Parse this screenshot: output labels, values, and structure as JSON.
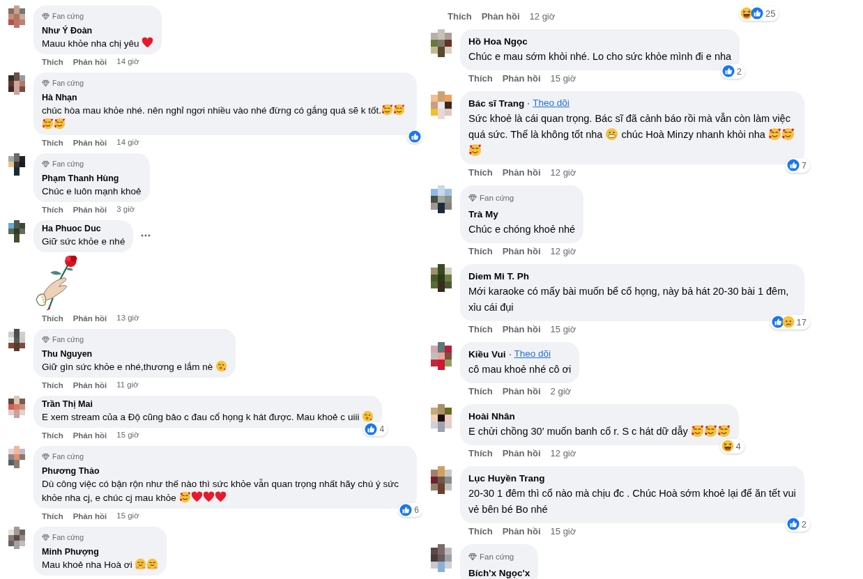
{
  "columns": [
    {
      "comments": [
        {
          "badge": "Fan cứng",
          "name": "Như Ý Đoàn",
          "segments": [
            {
              "kind": "text",
              "text": "Mauu khỏe nha chị yêu "
            },
            {
              "kind": "heart"
            }
          ],
          "actions": {
            "like": "Thích",
            "reply": "Phản hồi",
            "time": "14 giờ"
          }
        },
        {
          "badge": "Fan cứng",
          "name": "Hà Nhạn",
          "segments": [
            {
              "kind": "text",
              "text": "chúc hòa mau khỏe nhé. nên nghỉ ngơi nhiều vào nhé đừng có gắng quá sẽ k tốt."
            },
            {
              "kind": "hearts-face"
            },
            {
              "kind": "hearts-face"
            },
            {
              "kind": "hearts-face"
            },
            {
              "kind": "hearts-face"
            }
          ],
          "reactions": {
            "icons": [
              {
                "kind": "like"
              }
            ]
          },
          "actions": {
            "like": "Thích",
            "reply": "Phản hồi",
            "time": "14 giờ"
          }
        },
        {
          "badge": "Fan cứng",
          "name": "Phạm Thanh Hùng",
          "segments": [
            {
              "kind": "text",
              "text": "Chúc e luôn mạnh khoẻ"
            }
          ],
          "actions": {
            "like": "Thích",
            "reply": "Phản hồi",
            "time": "3 giờ"
          }
        },
        {
          "name": "Ha Phuoc Duc",
          "segments": [
            {
              "kind": "text",
              "text": "Giữ sức khỏe e nhé"
            }
          ],
          "more_menu": true,
          "sticker": true,
          "actions": {
            "like": "Thích",
            "reply": "Phản hồi",
            "time": "13 giờ"
          }
        },
        {
          "badge": "Fan cứng",
          "name": "Thu Nguyen",
          "segments": [
            {
              "kind": "text",
              "text": "Giữ gìn sức khỏe e nhé,thương e lắm nè "
            },
            {
              "kind": "kiss-face"
            }
          ],
          "actions": {
            "like": "Thích",
            "reply": "Phản hồi",
            "time": "11 giờ"
          }
        },
        {
          "name": "Trần Thị Mai",
          "segments": [
            {
              "kind": "text",
              "text": "E xem stream của a Độ cũng bảo c đau cổ họng k hát được. Mau khoẻ c uiii "
            },
            {
              "kind": "kiss-face"
            }
          ],
          "reactions": {
            "icons": [
              {
                "kind": "like"
              }
            ],
            "count": "4"
          },
          "actions": {
            "like": "Thích",
            "reply": "Phản hồi",
            "time": "15 giờ"
          }
        },
        {
          "badge": "Fan cứng",
          "name": "Phương Thảo",
          "segments": [
            {
              "kind": "text",
              "text": "Dù công việc có bận rộn như thế nào thì sức khỏe vẫn quan trọng nhất hãy chú ý sức khỏe nha cj, e chúc cj mau khỏe "
            },
            {
              "kind": "hearts-face"
            },
            {
              "kind": "heart"
            },
            {
              "kind": "heart"
            },
            {
              "kind": "heart"
            }
          ],
          "reactions": {
            "icons": [
              {
                "kind": "like"
              }
            ],
            "count": "6"
          },
          "actions": {
            "like": "Thích",
            "reply": "Phản hồi",
            "time": "15 giờ"
          }
        },
        {
          "badge": "Fan cứng",
          "name": "Minh Phượng",
          "segments": [
            {
              "kind": "text",
              "text": "Mau khoẻ nha Hoà ơi "
            },
            {
              "kind": "hug-face"
            },
            {
              "kind": "hug-face"
            }
          ]
        }
      ]
    },
    {
      "comments": [
        {
          "reactions": {
            "icons": [
              {
                "kind": "haha"
              },
              {
                "kind": "like"
              }
            ],
            "count": "25"
          },
          "actions": {
            "like": "Thích",
            "reply": "Phản hồi",
            "time": "12 giờ"
          }
        },
        {
          "name": "Hồ Hoa Ngọc",
          "segments": [
            {
              "kind": "text",
              "text": "Chúc e mau sớm khỏi nhé. Lo cho sức khỏe mình đi e nha"
            }
          ],
          "reactions": {
            "icons": [
              {
                "kind": "like"
              }
            ],
            "count": "2"
          },
          "actions": {
            "like": "Thích",
            "reply": "Phản hồi",
            "time": "15 giờ"
          }
        },
        {
          "name": "Bác sĩ Trang",
          "follow": "Theo dõi",
          "segments": [
            {
              "kind": "text",
              "text": "Sức khoẻ là cái quan trọng. Bác sĩ đã cảnh báo rồi mà vẫn còn làm việc quá sức. Thế là không tốt nha "
            },
            {
              "kind": "grin-face"
            },
            {
              "kind": "text",
              "text": " chúc Hoà Minzy nhanh khỏi nha "
            },
            {
              "kind": "hearts-face"
            },
            {
              "kind": "hearts-face"
            },
            {
              "kind": "hearts-face"
            }
          ],
          "reactions": {
            "icons": [
              {
                "kind": "like"
              }
            ],
            "count": "7"
          },
          "actions": {
            "like": "Thích",
            "reply": "Phản hồi",
            "time": "12 giờ"
          }
        },
        {
          "badge": "Fan cứng",
          "name": "Trà My",
          "segments": [
            {
              "kind": "text",
              "text": "Chúc e chóng khoẻ nhé"
            }
          ],
          "actions": {
            "like": "Thích",
            "reply": "Phản hồi",
            "time": "12 giờ"
          }
        },
        {
          "name": "Diem Mi T. Ph",
          "segments": [
            {
              "kind": "text",
              "text": "Mới karaoke có mấy bài muốn bể cổ họng, này bả hát 20-30 bài 1 đêm, xỉu cái đụi"
            }
          ],
          "reactions": {
            "icons": [
              {
                "kind": "like"
              },
              {
                "kind": "sad"
              }
            ],
            "count": "17"
          },
          "actions": {
            "like": "Thích",
            "reply": "Phản hồi",
            "time": "15 giờ"
          }
        },
        {
          "name": "Kiều Vui",
          "follow": "Theo dõi",
          "segments": [
            {
              "kind": "text",
              "text": "cô mau khoẻ nhé cô ơi"
            }
          ],
          "actions": {
            "like": "Thích",
            "reply": "Phản hồi",
            "time": "2 giờ"
          }
        },
        {
          "name": "Hoài Nhân",
          "segments": [
            {
              "kind": "text",
              "text": "E chửi chồng 30′ muốn banh cổ r. S c hát dữ dẫy "
            },
            {
              "kind": "hearts-face"
            },
            {
              "kind": "hearts-face"
            },
            {
              "kind": "hearts-face"
            }
          ],
          "reactions": {
            "icons": [
              {
                "kind": "haha"
              }
            ],
            "count": "4"
          },
          "actions": {
            "like": "Thích",
            "reply": "Phản hồi",
            "time": "12 giờ"
          }
        },
        {
          "name": "Lục Huyền Trang",
          "segments": [
            {
              "kind": "text",
              "text": "20-30 1 đêm thì cổ nào mà chịu đc . Chúc Hoà sớm khoẻ lại để ăn tết vui vẻ bên bé Bo nhé"
            }
          ],
          "reactions": {
            "icons": [
              {
                "kind": "like"
              }
            ],
            "count": "2"
          },
          "actions": {
            "like": "Thích",
            "reply": "Phản hồi",
            "time": "15 giờ"
          }
        },
        {
          "badge": "Fan cứng",
          "name": "Bích'x Ngọc'x"
        }
      ]
    }
  ]
}
